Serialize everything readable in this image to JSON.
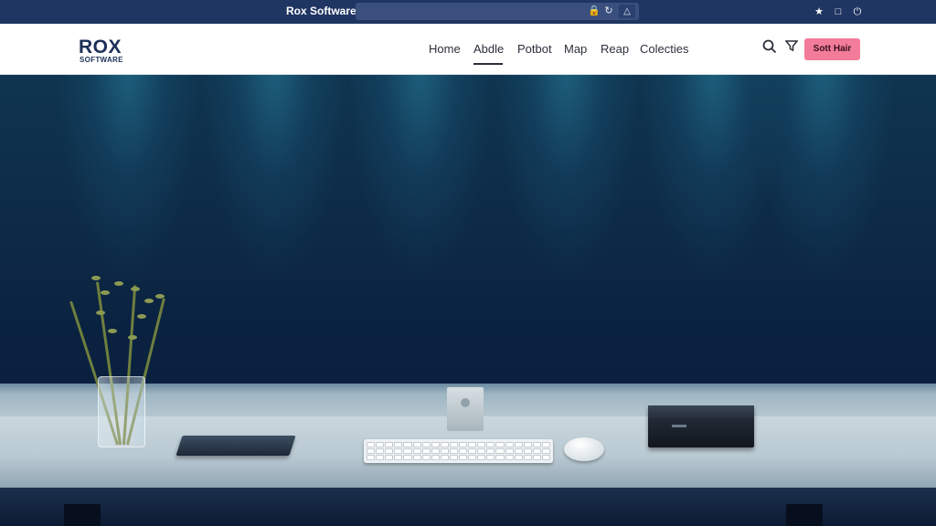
{
  "browser": {
    "title": "Rox Software",
    "address_icons": [
      "lock-icon",
      "refresh-icon",
      "shield-icon"
    ],
    "right_icons": [
      "bookmark-icon",
      "tab-icon",
      "power-icon"
    ]
  },
  "header": {
    "logo_main": "ROX",
    "logo_sub": "SOFTWARE",
    "nav": [
      {
        "label": "Home"
      },
      {
        "label": "Abdle"
      },
      {
        "label": "Potbot"
      },
      {
        "label": "Map"
      },
      {
        "label": "Reap"
      },
      {
        "label": "Colecties"
      }
    ],
    "active_nav": "Abdle",
    "cta_label": "Sott Hair"
  },
  "colors": {
    "browser_bar": "#1f3562",
    "accent_pink": "#f27c99",
    "logo_navy": "#1d3057",
    "hero_dark": "#0a2140"
  },
  "hero": {
    "scene": "dark wall with teal spotlights above a white desk with plant vase, notebook, tablet, keyboard, mouse and black device"
  }
}
